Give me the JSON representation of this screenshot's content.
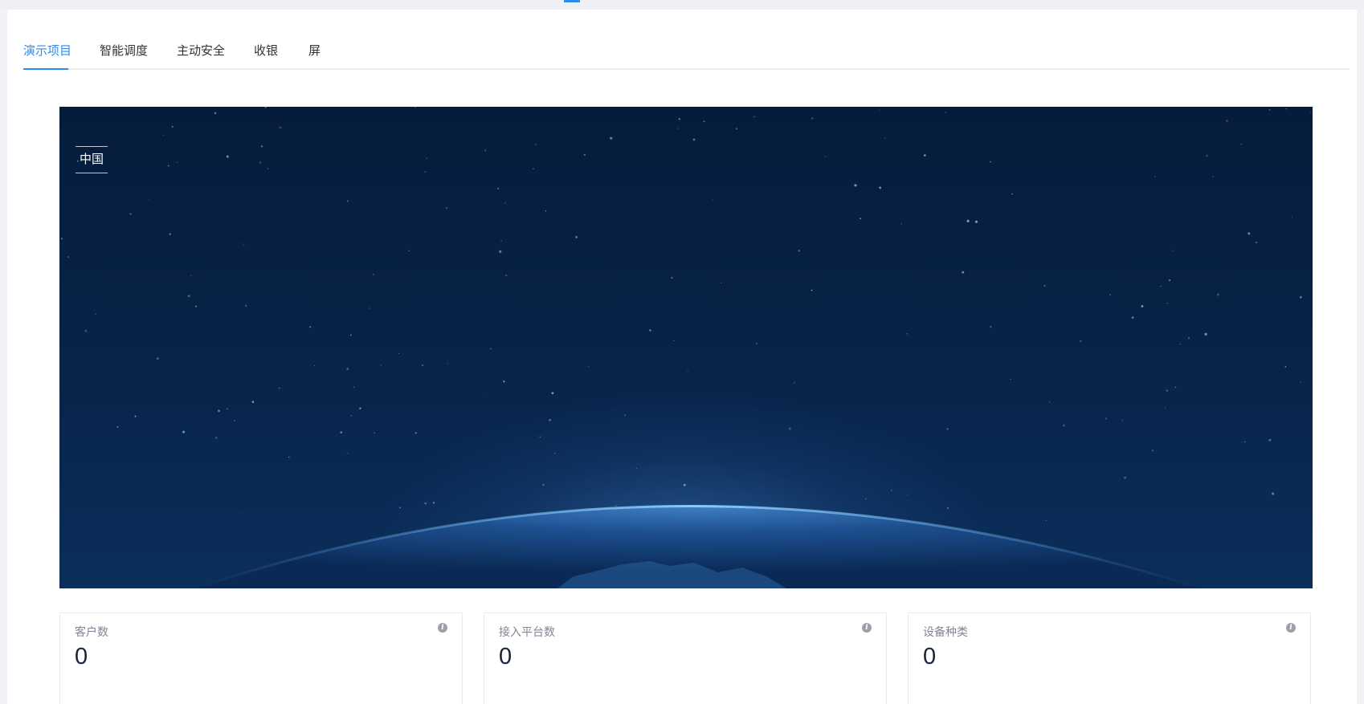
{
  "tabs": [
    {
      "label": "演示项目",
      "active": true
    },
    {
      "label": "智能调度",
      "active": false
    },
    {
      "label": "主动安全",
      "active": false
    },
    {
      "label": "收银",
      "active": false
    },
    {
      "label": "屏",
      "active": false
    }
  ],
  "banner": {
    "region_label": "中国"
  },
  "stats": [
    {
      "label": "客户数",
      "value": "0",
      "info_icon": "info-icon"
    },
    {
      "label": "接入平台数",
      "value": "0",
      "info_icon": "info-icon"
    },
    {
      "label": "设备种类",
      "value": "0",
      "info_icon": "info-icon"
    }
  ],
  "colors": {
    "accent": "#2d8cf0",
    "banner_dark": "#061c3b",
    "banner_glow": "#488cd2"
  }
}
